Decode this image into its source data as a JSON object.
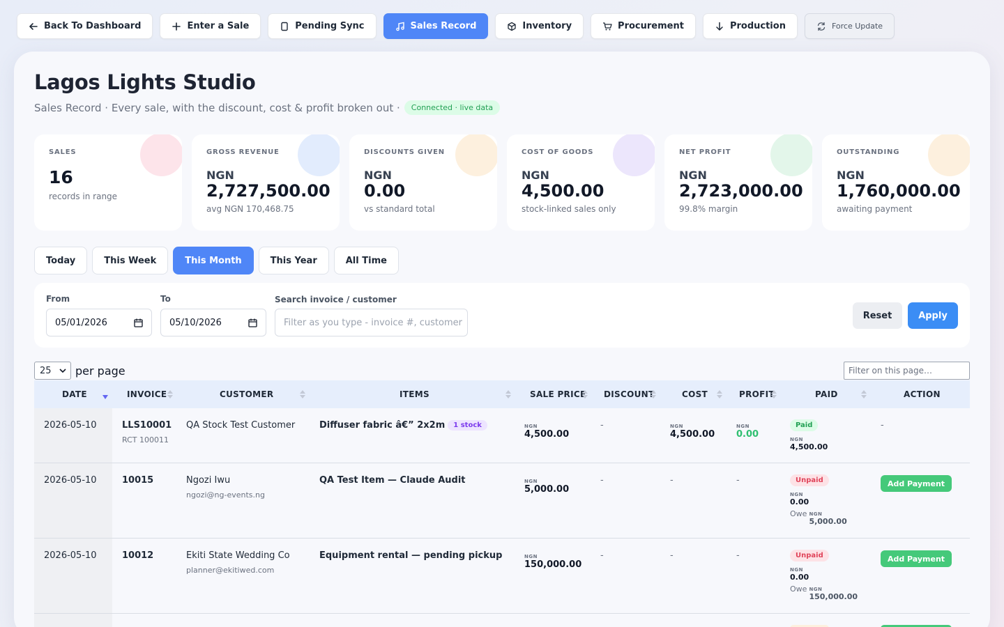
{
  "nav": [
    {
      "label": "Back To Dashboard",
      "icon": "arrow-left-icon"
    },
    {
      "label": "Enter a Sale",
      "icon": "plus-icon"
    },
    {
      "label": "Pending Sync",
      "icon": "document-icon"
    },
    {
      "label": "Sales Record",
      "icon": "music-note-icon",
      "active": true
    },
    {
      "label": "Inventory",
      "icon": "cube-icon"
    },
    {
      "label": "Procurement",
      "icon": "cart-icon"
    },
    {
      "label": "Production",
      "icon": "arrow-down-icon"
    },
    {
      "label": "Force Update",
      "icon": "refresh-icon"
    }
  ],
  "header": {
    "title": "Lagos Lights Studio",
    "subtitle": "Sales Record · Every sale, with the discount, cost & profit broken out ·",
    "status": "Connected · live data"
  },
  "stats": [
    {
      "label": "SALES",
      "value": "16",
      "sub": "records in range",
      "color": "#fde4ea"
    },
    {
      "label": "GROSS REVENUE",
      "currency": "NGN",
      "value": "2,727,500.00",
      "sub": "avg NGN 170,468.75",
      "color": "#e2ecfd"
    },
    {
      "label": "DISCOUNTS GIVEN",
      "currency": "NGN",
      "value": "0.00",
      "sub": "vs standard total",
      "color": "#fdf0de"
    },
    {
      "label": "COST OF GOODS",
      "currency": "NGN",
      "value": "4,500.00",
      "sub": "stock-linked sales only",
      "color": "#ece6fc"
    },
    {
      "label": "NET PROFIT",
      "currency": "NGN",
      "value": "2,723,000.00",
      "sub": "99.8% margin",
      "color": "#e3f6ea"
    },
    {
      "label": "OUTSTANDING",
      "currency": "NGN",
      "value": "1,760,000.00",
      "sub": "awaiting payment",
      "color": "#fdf0de"
    }
  ],
  "ranges": [
    {
      "label": "Today"
    },
    {
      "label": "This Week"
    },
    {
      "label": "This Month",
      "active": true
    },
    {
      "label": "This Year"
    },
    {
      "label": "All Time"
    }
  ],
  "filters": {
    "from_label": "From",
    "from_value": "05/01/2026",
    "to_label": "To",
    "to_value": "05/10/2026",
    "search_label": "Search invoice / customer",
    "search_placeholder": "Filter as you type - invoice #, customer",
    "reset": "Reset",
    "apply": "Apply"
  },
  "table_controls": {
    "per_page": "25",
    "per_page_label": "per page",
    "page_filter_placeholder": "Filter on this page…"
  },
  "columns": [
    "DATE",
    "INVOICE",
    "CUSTOMER",
    "ITEMS",
    "SALE PRICE",
    "DISCOUNT",
    "COST",
    "PROFIT",
    "PAID",
    "ACTION"
  ],
  "rows": [
    {
      "date": "2026-05-10",
      "invoice": "LLS10001",
      "invoice_sub": "RCT 100011",
      "customer": "QA Stock Test Customer",
      "customer_sub": "",
      "item": "Diffuser fabric â€” 2x2m",
      "item_pill": "1 stock",
      "currency": "NGN",
      "sale_price": "4,500.00",
      "discount": "-",
      "cost": "4,500.00",
      "profit": "0.00",
      "status": "Paid",
      "paid_amount": "4,500.00",
      "owe": "",
      "action": "-"
    },
    {
      "date": "2026-05-10",
      "invoice": "10015",
      "invoice_sub": "",
      "customer": "Ngozi Iwu",
      "customer_sub": "ngozi@ng-events.ng",
      "item": "QA Test Item — Claude Audit",
      "item_pill": "",
      "currency": "NGN",
      "sale_price": "5,000.00",
      "discount": "-",
      "cost": "-",
      "profit": "-",
      "status": "Unpaid",
      "paid_amount": "0.00",
      "owe_label": "Owe",
      "owe": "5,000.00",
      "action": "Add Payment"
    },
    {
      "date": "2026-05-10",
      "invoice": "10012",
      "invoice_sub": "",
      "customer": "Ekiti State Wedding Co",
      "customer_sub": "planner@ekitiwed.com",
      "item": "Equipment rental — pending pickup",
      "item_pill": "",
      "currency": "NGN",
      "sale_price": "150,000.00",
      "discount": "-",
      "cost": "-",
      "profit": "-",
      "status": "Unpaid",
      "paid_amount": "0.00",
      "owe_label": "Owe",
      "owe": "150,000.00",
      "action": "Add Payment"
    }
  ]
}
